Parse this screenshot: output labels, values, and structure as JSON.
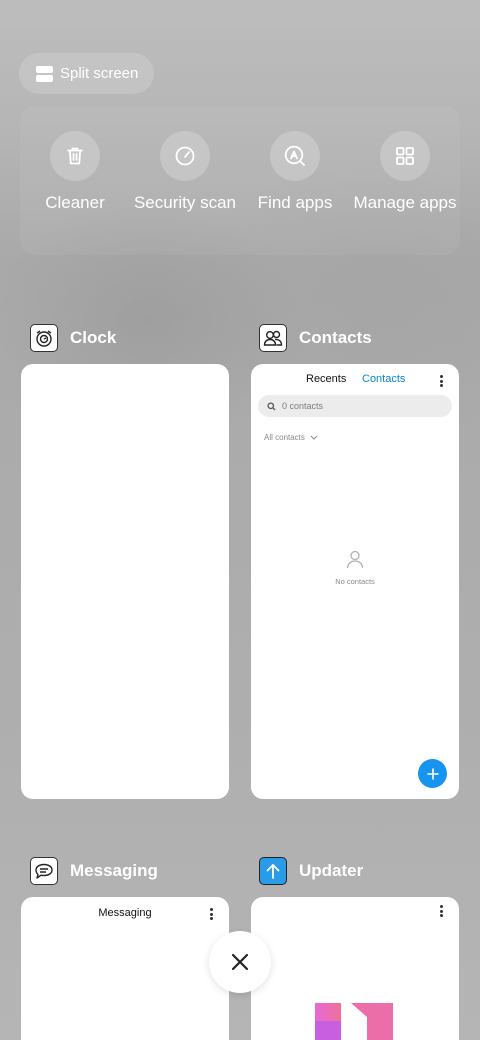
{
  "split_screen": {
    "label": "Split screen",
    "icon": "split-screen-icon"
  },
  "tools": [
    {
      "label": "Cleaner",
      "icon": "trash-icon"
    },
    {
      "label": "Security scan",
      "icon": "gauge-icon"
    },
    {
      "label": "Find apps",
      "icon": "find-apps-icon"
    },
    {
      "label": "Manage apps",
      "icon": "grid-icon"
    }
  ],
  "apps": {
    "clock": {
      "name": "Clock",
      "icon": "clock-app-icon"
    },
    "contacts": {
      "name": "Contacts",
      "icon": "contacts-app-icon",
      "tabs": [
        "Recents",
        "Contacts"
      ],
      "search_placeholder": "0 contacts",
      "filter": "All contacts",
      "empty_text": "No contacts"
    },
    "messaging": {
      "name": "Messaging",
      "icon": "messaging-app-icon",
      "title": "Messaging"
    },
    "updater": {
      "name": "Updater",
      "icon": "updater-app-icon"
    }
  },
  "colors": {
    "accent": "#0a84d6",
    "fab": "#1794ef",
    "updater": "#2a9be6"
  },
  "close_icon": "close-icon"
}
